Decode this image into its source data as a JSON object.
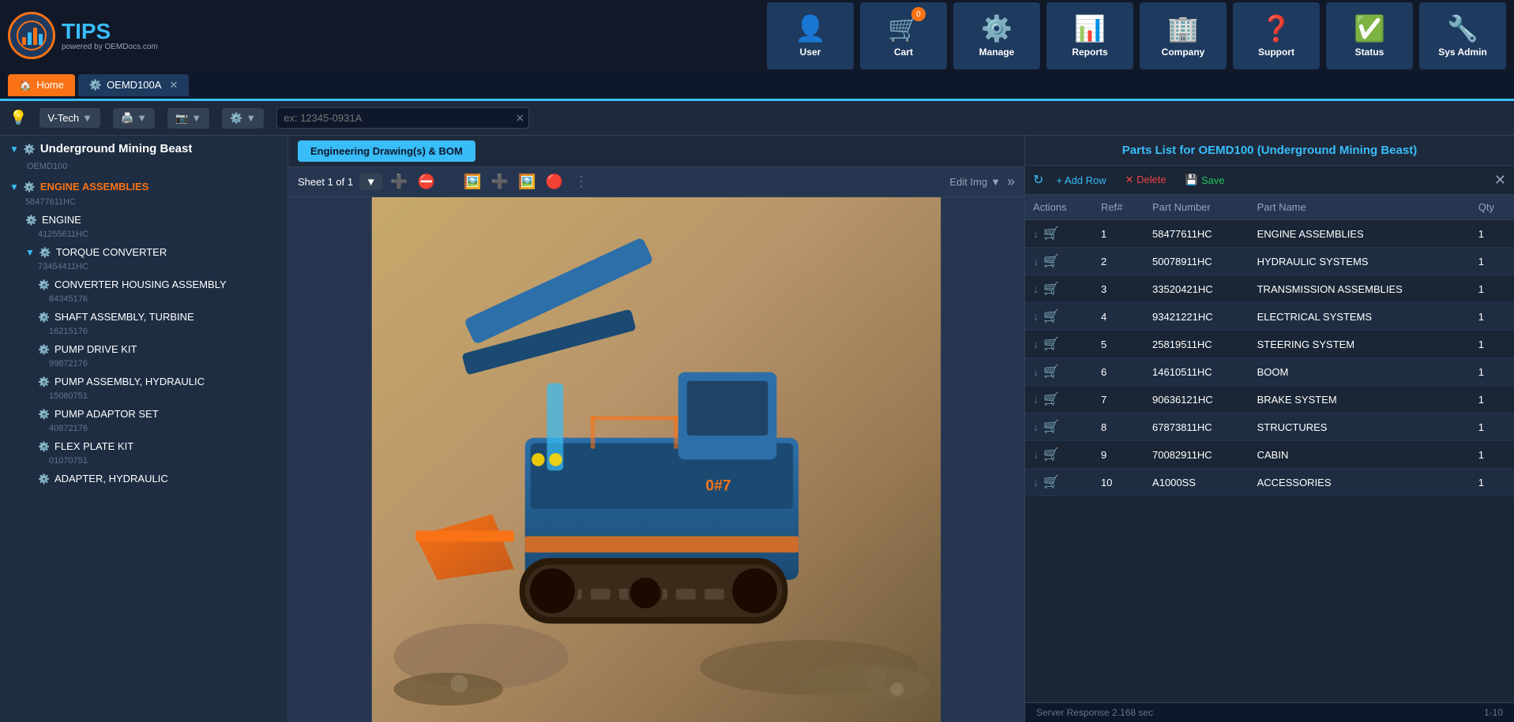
{
  "logo": {
    "name": "TIPS",
    "sub": "powered by OEMDocs.com"
  },
  "nav": {
    "items": [
      {
        "id": "user",
        "label": "User",
        "icon": "👤"
      },
      {
        "id": "cart",
        "label": "Cart",
        "icon": "🛒",
        "badge": "0"
      },
      {
        "id": "manage",
        "label": "Manage",
        "icon": "⚙️"
      },
      {
        "id": "reports",
        "label": "Reports",
        "icon": "📊"
      },
      {
        "id": "company",
        "label": "Company",
        "icon": "🏢"
      },
      {
        "id": "support",
        "label": "Support",
        "icon": "❓"
      },
      {
        "id": "status",
        "label": "Status",
        "icon": "✅"
      },
      {
        "id": "sysadmin",
        "label": "Sys Admin",
        "icon": "🔧"
      }
    ]
  },
  "tabs": [
    {
      "id": "home",
      "label": "Home",
      "type": "home"
    },
    {
      "id": "oemd100a",
      "label": "OEMD100A",
      "type": "active",
      "closeable": true
    }
  ],
  "toolbar": {
    "workspace": "V-Tech",
    "search_placeholder": "ex: 12345-0931A"
  },
  "sidebar": {
    "root": {
      "name": "Underground Mining Beast",
      "code": "OEMD100"
    },
    "sections": [
      {
        "id": "engine-assemblies",
        "label": "ENGINE ASSEMBLIES",
        "code": "58477611HC",
        "expanded": true,
        "children": [
          {
            "id": "engine",
            "label": "ENGINE",
            "code": "41255611HC",
            "level": 1
          },
          {
            "id": "torque-converter",
            "label": "TORQUE CONVERTER",
            "code": "73454411HC",
            "expanded": true,
            "level": 1,
            "children": [
              {
                "id": "converter-housing",
                "label": "CONVERTER HOUSING ASSEMBLY",
                "code": "84345176",
                "level": 2
              },
              {
                "id": "shaft-assembly",
                "label": "SHAFT ASSEMBLY, TURBINE",
                "code": "16215176",
                "level": 2
              },
              {
                "id": "pump-drive-kit",
                "label": "PUMP DRIVE KIT",
                "code": "99872176",
                "level": 2
              },
              {
                "id": "pump-assembly",
                "label": "PUMP ASSEMBLY, HYDRAULIC",
                "code": "15080751",
                "level": 2
              },
              {
                "id": "pump-adaptor-set",
                "label": "PUMP ADAPTOR SET",
                "code": "40872176",
                "level": 2
              },
              {
                "id": "flex-plate-kit",
                "label": "FLEX PLATE KIT",
                "code": "01070751",
                "level": 2
              },
              {
                "id": "adapter-hydraulic",
                "label": "ADAPTER, HYDRAULIC",
                "code": "",
                "level": 2
              }
            ]
          }
        ]
      }
    ]
  },
  "drawing": {
    "tab_label": "Engineering Drawing(s) & BOM",
    "sheet_label": "Sheet 1 of 1",
    "edit_img_label": "Edit Img"
  },
  "parts_list": {
    "title_prefix": "Parts List for",
    "model": "OEMD100",
    "model_name": "(Underground Mining Beast)",
    "add_row": "+ Add Row",
    "delete": "✕ Delete",
    "save": "Save",
    "columns": [
      "Actions",
      "Ref#",
      "Part Number",
      "Part Name",
      "Qty"
    ],
    "rows": [
      {
        "ref": "1",
        "part_number": "58477611HC",
        "part_name": "ENGINE ASSEMBLIES",
        "qty": "1"
      },
      {
        "ref": "2",
        "part_number": "50078911HC",
        "part_name": "HYDRAULIC SYSTEMS",
        "qty": "1"
      },
      {
        "ref": "3",
        "part_number": "33520421HC",
        "part_name": "TRANSMISSION ASSEMBLIES",
        "qty": "1"
      },
      {
        "ref": "4",
        "part_number": "93421221HC",
        "part_name": "ELECTRICAL SYSTEMS",
        "qty": "1"
      },
      {
        "ref": "5",
        "part_number": "25819511HC",
        "part_name": "STEERING SYSTEM",
        "qty": "1"
      },
      {
        "ref": "6",
        "part_number": "14610511HC",
        "part_name": "BOOM",
        "qty": "1"
      },
      {
        "ref": "7",
        "part_number": "90636121HC",
        "part_name": "BRAKE SYSTEM",
        "qty": "1"
      },
      {
        "ref": "8",
        "part_number": "67873811HC",
        "part_name": "STRUCTURES",
        "qty": "1"
      },
      {
        "ref": "9",
        "part_number": "70082911HC",
        "part_name": "CABIN",
        "qty": "1"
      },
      {
        "ref": "10",
        "part_number": "A1000SS",
        "part_name": "ACCESSORIES",
        "qty": "1"
      }
    ],
    "footer_server": "Server Response 2.168 sec",
    "footer_pages": "1-10"
  }
}
